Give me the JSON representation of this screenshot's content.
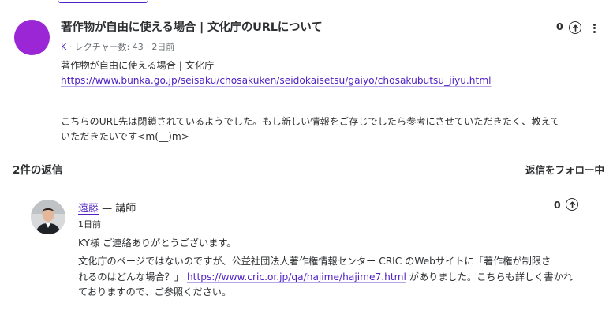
{
  "question": {
    "title": "著作物が自由に使える場合 | 文化庁のURLについて",
    "author": "K",
    "lecture": "レクチャー数: 43",
    "time": "2日前",
    "upvotes": "0",
    "body_line1": "著作物が自由に使える場合 | 文化庁",
    "body_link": "https://www.bunka.go.jp/seisaku/chosakuken/seidokaisetsu/gaiyo/chosakubutsu_jiyu.html",
    "body_line3": "こちらのURL先は閉鎖されているようでした。もし新しい情報をご存じでしたら参考にさせていただきたく、教えて",
    "body_line4": "いただきたいです<m(__)m>"
  },
  "replies": {
    "heading": "2件の返信",
    "follow_label": "返信をフォロー中"
  },
  "reply": {
    "name": "遠藤",
    "role": "— 講師",
    "time": "1日前",
    "upvotes": "0",
    "line1": "KY様 ご連絡ありがとうございます。",
    "line2": "文化庁のページではないのですが、公益社団法人著作権情報センター CRIC のWebサイトに「著作権が制限さ",
    "line3_pre": "れるのはどんな場合？」 ",
    "link": "https://www.cric.or.jp/qa/hajime/hajime7.html",
    "line3_post": " がありました。こちらも詳しく書かれ",
    "line4": "ておりますので、ご参照ください。"
  },
  "colors": {
    "accent": "#5022c3",
    "avatar": "#9b26d6",
    "text": "#2d2f31"
  }
}
